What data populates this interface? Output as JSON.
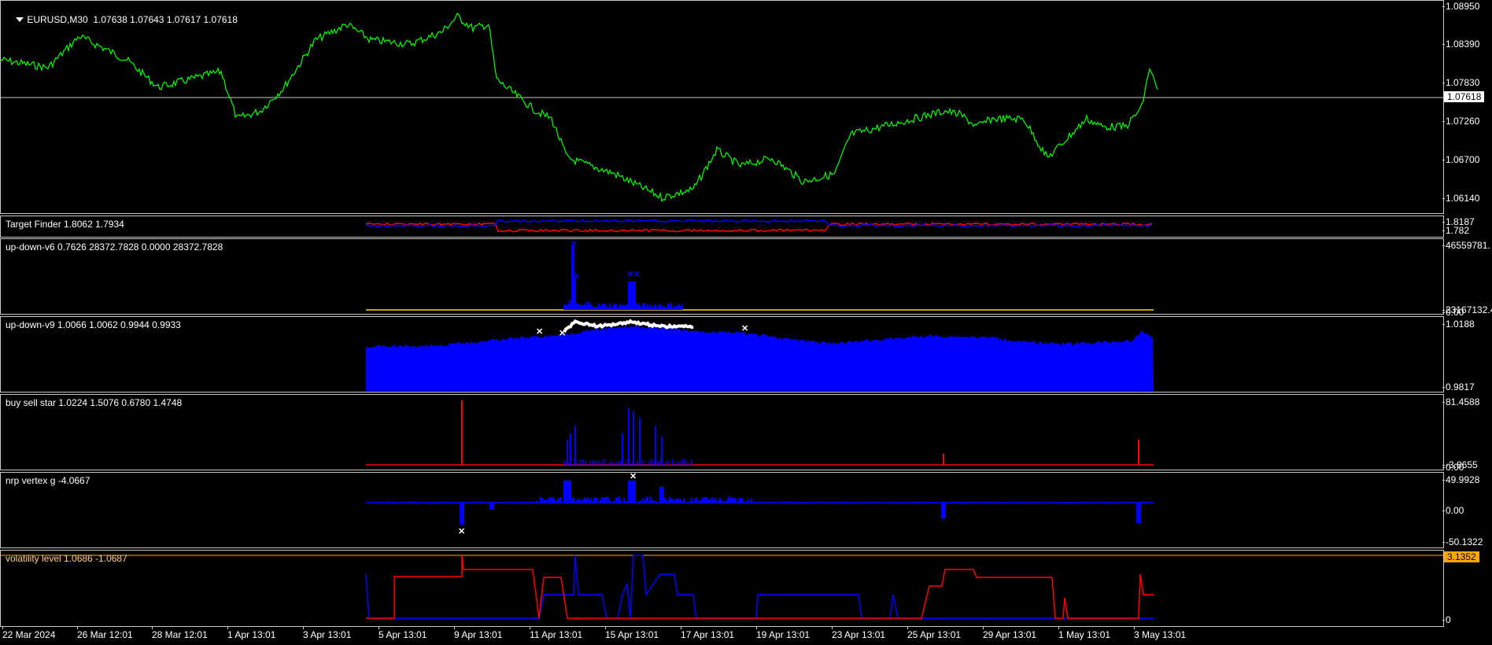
{
  "colors": {
    "background": "#000000",
    "price_line": "#00ff00",
    "up": "#0000ff",
    "down": "#ff0000",
    "yellow": "#ffd700",
    "white": "#ffffff",
    "tag_orange": "#ffa500",
    "grid": "#c8c8c8"
  },
  "main": {
    "symbol_label": "EURUSD,M30",
    "ohlc_label": "1.07638 1.07643 1.07617 1.07618",
    "ticks": [
      "1.08950",
      "1.08390",
      "1.07830",
      "1.07260",
      "1.06700",
      "1.06140"
    ],
    "current_price": "1.07618"
  },
  "panes": [
    {
      "id": "target-finder",
      "title": "Target Finder 1.8062 1.7934",
      "ticks": [
        "1.8187",
        "1.782"
      ]
    },
    {
      "id": "up-down-v6",
      "title": "up-down-v6 0.7626 28372.7828 0.0000 28372.7828",
      "ticks": [
        "46559781.",
        "23167132.4",
        "0.00"
      ]
    },
    {
      "id": "up-down-v9",
      "title": "up-down-v9 1.0066 1.0062 0.9944 0.9933",
      "ticks": [
        "1.0188",
        "0.9817"
      ]
    },
    {
      "id": "buy-sell-star",
      "title": "buy sell star 1.0224 1.5076 0.6780 1.4748",
      "ticks": [
        "81.4588",
        "-3.8655",
        "0.00"
      ]
    },
    {
      "id": "nrp-vertex-g",
      "title": "nrp vertex g -4.0667",
      "ticks": [
        "49.9928",
        "0.00",
        "-50.1322"
      ]
    },
    {
      "id": "volatility-level",
      "title": "volatility level 1.0686 -1.0687",
      "ticks": [
        "3.1352",
        "0"
      ]
    }
  ],
  "time_axis": [
    "22 Mar 2024",
    "26 Mar 12:01",
    "28 Mar 12:01",
    "1 Apr 13:01",
    "3 Apr 13:01",
    "5 Apr 13:01",
    "9 Apr 13:01",
    "11 Apr 13:01",
    "15 Apr 13:01",
    "17 Apr 13:01",
    "19 Apr 13:01",
    "23 Apr 13:01",
    "25 Apr 13:01",
    "29 Apr 13:01",
    "1 May 13:01",
    "3 May 13:01"
  ]
}
